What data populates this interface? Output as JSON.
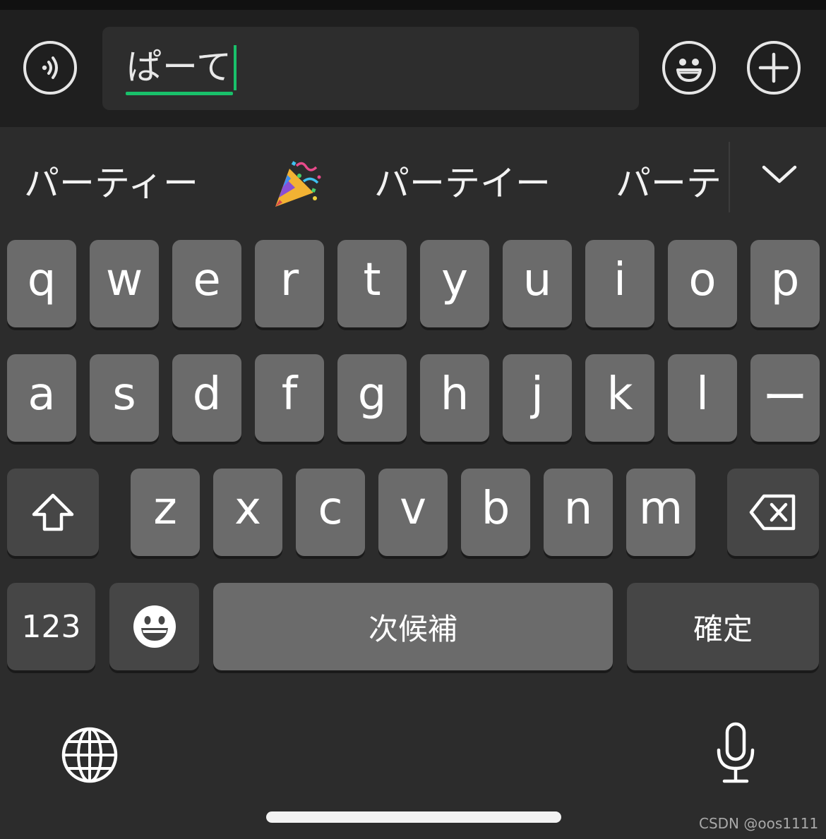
{
  "input_bar": {
    "composing_text": "ぱーて",
    "icons": {
      "voice": "voice-message-icon",
      "emoji": "smiley-icon",
      "plus": "plus-icon"
    },
    "underline_color": "#19c06a"
  },
  "candidates": {
    "items": [
      "パーティー",
      "パーテイー",
      "パーテ"
    ],
    "emoji_candidate": "party-popper-icon",
    "expand_icon": "chevron-down-icon"
  },
  "keyboard": {
    "row1": [
      "q",
      "w",
      "e",
      "r",
      "t",
      "y",
      "u",
      "i",
      "o",
      "p"
    ],
    "row2": [
      "a",
      "s",
      "d",
      "f",
      "g",
      "h",
      "j",
      "k",
      "l",
      "ー"
    ],
    "row3": [
      "z",
      "x",
      "c",
      "v",
      "b",
      "n",
      "m"
    ],
    "numbers_label": "123",
    "space_label": "次候補",
    "confirm_label": "確定",
    "icons": {
      "shift": "shift-icon",
      "backspace": "backspace-icon",
      "emoji": "emoji-face-icon",
      "globe": "globe-icon",
      "mic": "microphone-icon"
    },
    "colors": {
      "key": "#6b6b6b",
      "function_key": "#464646",
      "background": "#2c2c2c"
    }
  },
  "watermark": "CSDN @oos1111"
}
